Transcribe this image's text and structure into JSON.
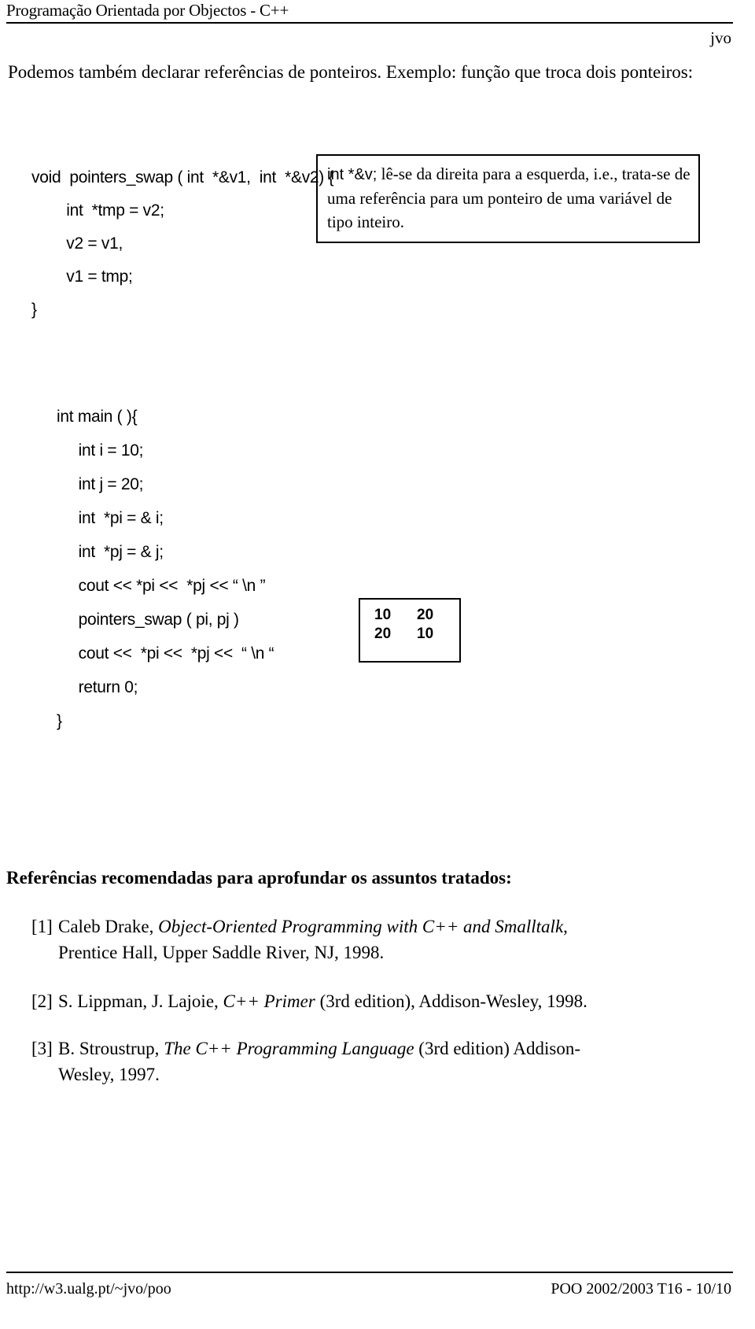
{
  "header": {
    "title": "Programação Orientada por Objectos - C++",
    "author_mark": "jvo"
  },
  "intro": {
    "paragraph": "Podemos também declarar referências de ponteiros. Exemplo: função que troca dois ponteiros:"
  },
  "code_block_1": {
    "lines": [
      "void  pointers_swap ( int  *&v1,  int  *&v2) {",
      "        int  *tmp = v2;",
      "        v2 = v1,",
      "        v1 = tmp;",
      "}"
    ]
  },
  "note_box": {
    "code_part": "int  *&v;",
    "text_part": " lê-se da direita para a esquerda, i.e., trata-se de uma referência para um ponteiro de uma variável de tipo inteiro."
  },
  "code_block_2": {
    "lines": [
      "int main ( ){",
      "     int i = 10;",
      "     int j = 20;",
      "     int  *pi = & i;",
      "     int  *pj = & j;",
      "     cout << *pi <<  *pj << “ \\n ”",
      "     pointers_swap ( pi, pj )",
      "     cout <<  *pi <<  *pj <<  “ \\n “",
      "     return 0;",
      "}"
    ]
  },
  "output_box": {
    "rows": [
      [
        "10",
        "20"
      ],
      [
        "20",
        "10"
      ]
    ]
  },
  "references": {
    "heading": "Referências recomendadas para aprofundar os assuntos tratados:",
    "items": [
      {
        "label": "[1]",
        "line1_pre": "Caleb  Drake,  ",
        "line1_italic": "Object-Oriented  Programming  with  C++  and  Smalltalk",
        "line1_post": ",",
        "line2": "Prentice Hall, Upper Saddle River, NJ, 1998."
      },
      {
        "label": "[2]",
        "line1_pre": "S. Lippman, J. Lajoie, ",
        "line1_italic": "C++ Primer",
        "line1_post": " (3rd edition), Addison-Wesley, 1998.",
        "line2": ""
      },
      {
        "label": "[3]",
        "line1_pre": "B. Stroustrup,  ",
        "line1_italic": "The  C++  Programming  Language",
        "line1_post": "  (3rd  edition)  Addison-",
        "line2": "Wesley, 1997."
      }
    ]
  },
  "footer": {
    "url": "http://w3.ualg.pt/~jvo/poo",
    "page_info": "POO 2002/2003 T16 - 10/10"
  }
}
